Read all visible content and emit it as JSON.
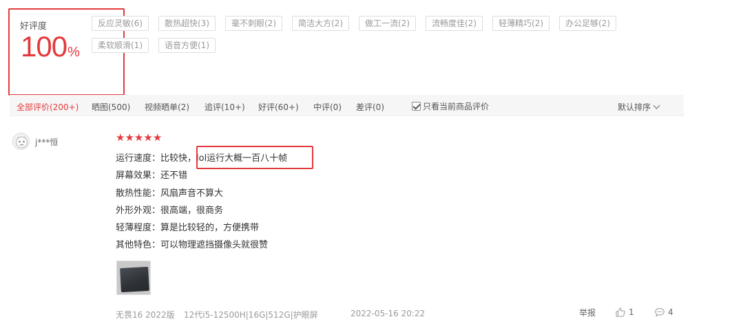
{
  "summary": {
    "label": "好评度",
    "value": "100",
    "unit": "%"
  },
  "tags": [
    "反应灵敏(6)",
    "散热超快(3)",
    "毫不刺眼(2)",
    "简洁大方(2)",
    "做工一流(2)",
    "流畅度佳(2)",
    "轻薄精巧(2)",
    "办公足够(2)",
    "柔软顺滑(1)",
    "语音方便(1)"
  ],
  "filters": {
    "all": "全部评价(200+)",
    "photos": "晒图(500)",
    "videos": "视频晒单(2)",
    "followup": "追评(10+)",
    "good": "好评(60+)",
    "medium": "中评(0)",
    "bad": "差评(0)",
    "only_current": "只看当前商品评价",
    "sort": "默认排序"
  },
  "review": {
    "username": "j***恒",
    "rating": 5,
    "lines": [
      "运行速度：比较快，lol运行大概一百八十帧",
      "屏幕效果：还不错",
      "散热性能：风扇声音不算大",
      "外形外观：很高端，很商务",
      "轻薄程度：算是比较轻的，方便携带",
      "其他特色：可以物理遮挡摄像头就很赞"
    ],
    "product_name": "无畏16 2022版",
    "product_spec": "12代i5-12500H|16G|512G|护眼屏",
    "date": "2022-05-16 20:22",
    "report": "举报",
    "likes": "1",
    "comments": "4"
  },
  "colors": {
    "accent": "#e4393c",
    "filter_bg": "#f6f6f6",
    "tag_border": "#dddddd"
  }
}
